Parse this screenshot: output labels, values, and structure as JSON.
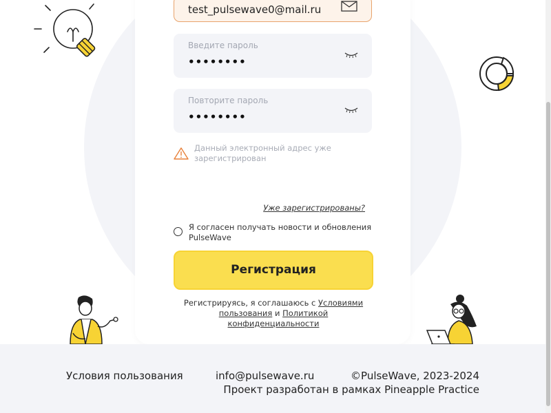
{
  "form": {
    "email_value": "test_pulsewave0@mail.ru",
    "password": {
      "label": "Введите пароль",
      "value": "••••••••"
    },
    "password_repeat": {
      "label": "Повторите пароль",
      "value": "••••••••"
    },
    "error_message": "Данный электронный адрес уже зарегистрирован",
    "login_link": "Уже зарегистрированы?",
    "consent_text": "Я согласен получать новости и обновления PulseWave",
    "submit_label": "Регистрация",
    "terms": {
      "prefix": "Регистрируясь, я соглашаюсь с ",
      "terms_link": "Условиями пользования",
      "conjunction": " и ",
      "privacy_link": "Политикой конфиденциальности"
    }
  },
  "footer": {
    "terms": "Условия пользования",
    "email": "info@pulsewave.ru",
    "copyright": "©PulseWave, 2023-2024",
    "project": "Проект разработан в рамках Pineapple Practice"
  },
  "colors": {
    "accent": "#fade4f",
    "error_border": "#e8a36b",
    "warning": "#e8813a",
    "field_bg": "#f3f4f8"
  },
  "icons": [
    "envelope-icon",
    "eye-closed-icon",
    "warning-icon",
    "lightbulb-illustration",
    "donut-chart-illustration",
    "man-illustration",
    "woman-laptop-illustration"
  ]
}
